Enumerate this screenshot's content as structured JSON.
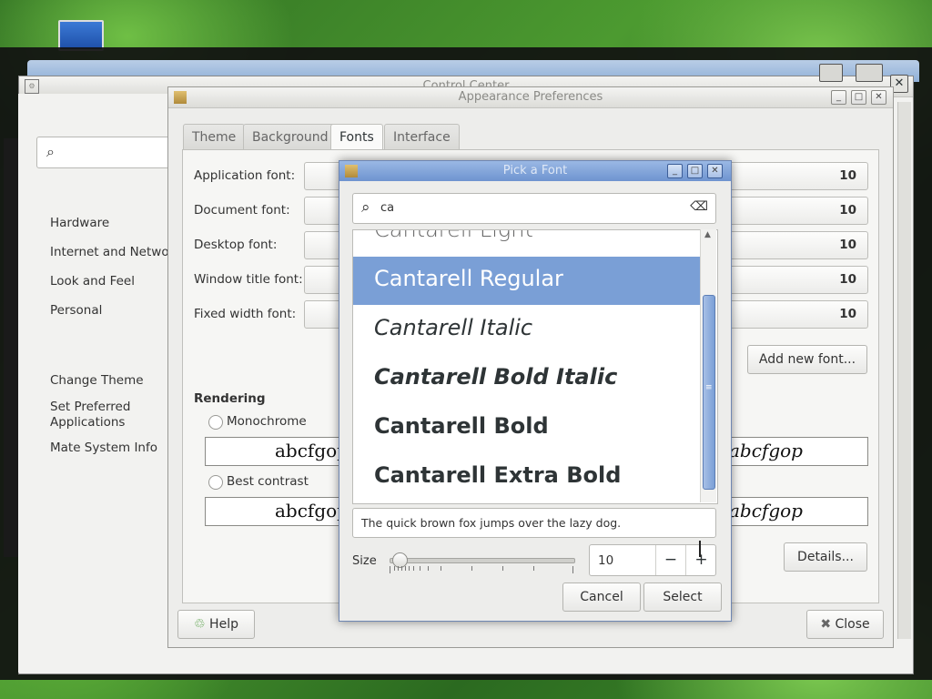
{
  "control_center": {
    "title": "Control Center",
    "categories": [
      "Hardware",
      "Internet and Network",
      "Look and Feel",
      "Personal"
    ],
    "common_tasks": [
      "Change Theme",
      "Set Preferred Applications",
      "Mate System Info"
    ]
  },
  "appearance": {
    "title": "Appearance Preferences",
    "tabs": [
      "Theme",
      "Background",
      "Fonts",
      "Interface"
    ],
    "active_tab": "Fonts",
    "fonts": [
      {
        "label": "Application font:",
        "size": "10"
      },
      {
        "label": "Document font:",
        "size": "10"
      },
      {
        "label": "Desktop font:",
        "size": "10"
      },
      {
        "label": "Window title font:",
        "size": "10"
      },
      {
        "label": "Fixed width font:",
        "size": "10"
      }
    ],
    "add_font_label": "Add new font...",
    "rendering_heading": "Rendering",
    "rendering_options": [
      "Monochrome",
      "Best contrast"
    ],
    "preview_text": "abcfgop",
    "details_label": "Details...",
    "help_label": "Help",
    "close_label": "Close"
  },
  "pick_font": {
    "title": "Pick a Font",
    "search_value": "ca",
    "fonts": [
      {
        "name": "Cantarell Light",
        "weight": 300,
        "style": "normal",
        "selected": false
      },
      {
        "name": "Cantarell Regular",
        "weight": 400,
        "style": "normal",
        "selected": true
      },
      {
        "name": "Cantarell Italic",
        "weight": 400,
        "style": "italic",
        "selected": false
      },
      {
        "name": "Cantarell Bold Italic",
        "weight": 700,
        "style": "italic",
        "selected": false
      },
      {
        "name": "Cantarell Bold",
        "weight": 600,
        "style": "normal",
        "selected": false
      },
      {
        "name": "Cantarell Extra Bold",
        "weight": 800,
        "style": "normal",
        "selected": false
      }
    ],
    "preview_sentence": "The quick brown fox jumps over the lazy dog.",
    "size_label": "Size",
    "size_value": "10",
    "minus_label": "−",
    "plus_label": "+",
    "cancel_label": "Cancel",
    "select_label": "Select"
  },
  "colors": {
    "selection": "#7a9fd6",
    "title_active": "#6e94d0"
  }
}
